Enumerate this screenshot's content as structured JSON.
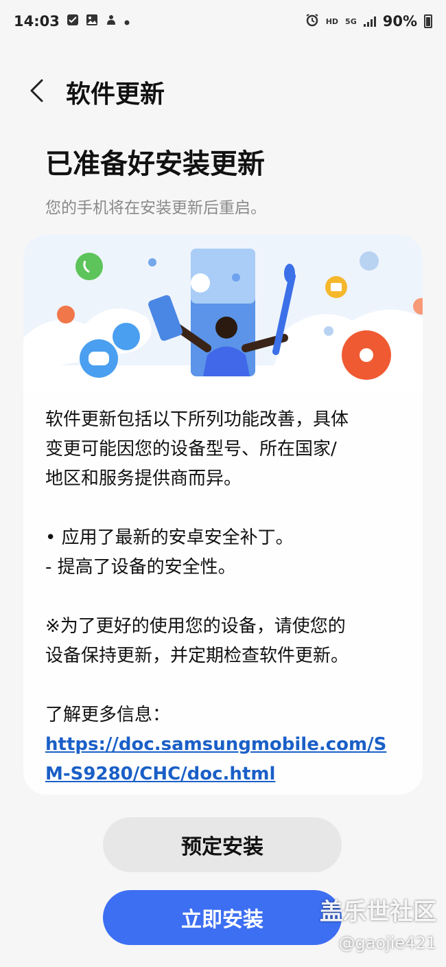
{
  "status_bar": {
    "time": "14:03",
    "left_icons": [
      "checkbox-icon",
      "gallery-icon",
      "notification-icon",
      "dot-icon"
    ],
    "hd": "HD",
    "network": "5G",
    "battery": "90%"
  },
  "header": {
    "back_icon": "chevron-left-icon",
    "title": "软件更新"
  },
  "page": {
    "title": "已准备好安装更新",
    "subtitle": "您的手机将在安装更新后重启。"
  },
  "card": {
    "intro": "软件更新包括以下所列功能改善，具体\n变更可能因您的设备型号、所在国家/\n地区和服务提供商而异。",
    "bullet": "• 应用了最新的安卓安全补丁。",
    "sub_bullet": " - 提高了设备的安全性。",
    "note": "※为了更好的使用您的设备，请使您的\n设备保持更新，并定期检查软件更新。",
    "more_info_label": "了解更多信息：",
    "link": "https://doc.samsungmobile.com/SM-S9280/CHC/doc.html"
  },
  "buttons": {
    "schedule": "预定安装",
    "install_now": "立即安装"
  },
  "watermark": {
    "name": "盖乐世社区",
    "user": "@gaojie421"
  },
  "colors": {
    "accent": "#3d6ff2",
    "link": "#1a5fc7",
    "background": "#f6f6f6"
  }
}
